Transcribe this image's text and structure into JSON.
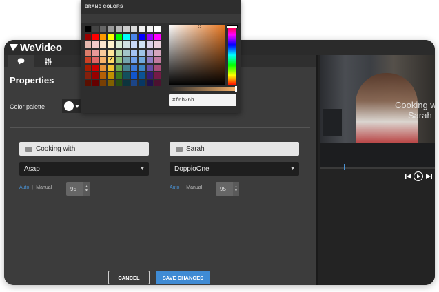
{
  "app": {
    "logo": "WeVideo"
  },
  "panel": {
    "title": "Properties"
  },
  "color_palette": {
    "label": "Color palette",
    "value": "#ffffff"
  },
  "text_fields": [
    {
      "text": "Cooking with",
      "font": "Asap",
      "size_mode_auto": "Auto",
      "size_mode_manual": "Manual",
      "size": "95"
    },
    {
      "text": "Sarah",
      "font": "DoppioOne",
      "size_mode_auto": "Auto",
      "size_mode_manual": "Manual",
      "size": "95"
    }
  ],
  "buttons": {
    "cancel": "CANCEL",
    "save": "SAVE CHANGES"
  },
  "preview": {
    "overlay_line1": "Cooking w",
    "overlay_line2": "Sarah"
  },
  "picker": {
    "title": "BRAND COLORS",
    "hex": "#f6b26b",
    "selected": {
      "row": 4,
      "col": 3
    },
    "swatches": [
      [
        "#000000",
        "#434343",
        "#666666",
        "#999999",
        "#b7b7b7",
        "#cccccc",
        "#d9d9d9",
        "#efefef",
        "#f3f3f3",
        "#ffffff"
      ],
      [
        "#980000",
        "#ff0000",
        "#ff9900",
        "#ffff00",
        "#00ff00",
        "#00ffff",
        "#4a86e8",
        "#0000ff",
        "#9900ff",
        "#ff00ff"
      ],
      [
        "#e6b8af",
        "#f4cccc",
        "#fce5cd",
        "#fff2cc",
        "#d9ead3",
        "#d0e0e3",
        "#c9daf8",
        "#cfe2f3",
        "#d9d2e9",
        "#ead1dc"
      ],
      [
        "#dd7e6b",
        "#ea9999",
        "#f9cb9c",
        "#ffe599",
        "#b6d7a8",
        "#a2c4c9",
        "#a4c2f4",
        "#9fc5e8",
        "#b4a7d6",
        "#d5a6bd"
      ],
      [
        "#cc4125",
        "#e06666",
        "#f6b26b",
        "#ffd966",
        "#93c47d",
        "#76a5af",
        "#6d9eeb",
        "#6fa8dc",
        "#8e7cc3",
        "#c27ba0"
      ],
      [
        "#a61c00",
        "#cc0000",
        "#e69138",
        "#f1c232",
        "#6aa84f",
        "#45818e",
        "#3c78d8",
        "#3d85c6",
        "#674ea7",
        "#a64d79"
      ],
      [
        "#85200c",
        "#990000",
        "#b45f06",
        "#bf9000",
        "#38761d",
        "#134f5c",
        "#1155cc",
        "#0b5394",
        "#351c75",
        "#741b47"
      ],
      [
        "#5b0f00",
        "#660000",
        "#783f04",
        "#7f6000",
        "#274e13",
        "#0c343d",
        "#1c4587",
        "#073763",
        "#20124d",
        "#4c1130"
      ]
    ]
  },
  "icons": {
    "logo": "wevideo-logo-icon",
    "tab_properties": "speech-bubble-icon",
    "tab_adjust": "sliders-icon",
    "prev": "skip-previous-icon",
    "play": "play-icon",
    "next": "skip-next-icon"
  }
}
